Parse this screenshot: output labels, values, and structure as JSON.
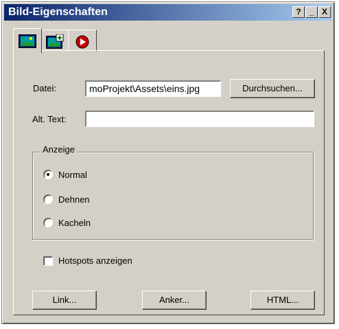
{
  "window": {
    "title": "Bild-Eigenschaften",
    "help_button": "?",
    "minimize_button": "_",
    "close_button": "X"
  },
  "tabs": [
    {
      "icon": "image-icon",
      "active": true
    },
    {
      "icon": "image-add-icon",
      "active": false
    },
    {
      "icon": "play-icon",
      "active": false
    }
  ],
  "file": {
    "label": "Datei:",
    "value": "moProjekt\\Assets\\eins.jpg",
    "browse_label": "Durchsuchen..."
  },
  "alt_text": {
    "label": "Alt. Text:",
    "value": ""
  },
  "display": {
    "title": "Anzeige",
    "options": [
      {
        "label": "Normal",
        "checked": true
      },
      {
        "label": "Dehnen",
        "checked": false
      },
      {
        "label": "Kacheln",
        "checked": false
      }
    ]
  },
  "hotspots": {
    "label": "Hotspots anzeigen",
    "checked": false
  },
  "buttons": {
    "link": "Link...",
    "anchor": "Anker...",
    "html": "HTML..."
  },
  "colors": {
    "dialog_bg": "#d4d0c8",
    "titlebar_start": "#0a246a",
    "titlebar_end": "#a6caf0"
  }
}
